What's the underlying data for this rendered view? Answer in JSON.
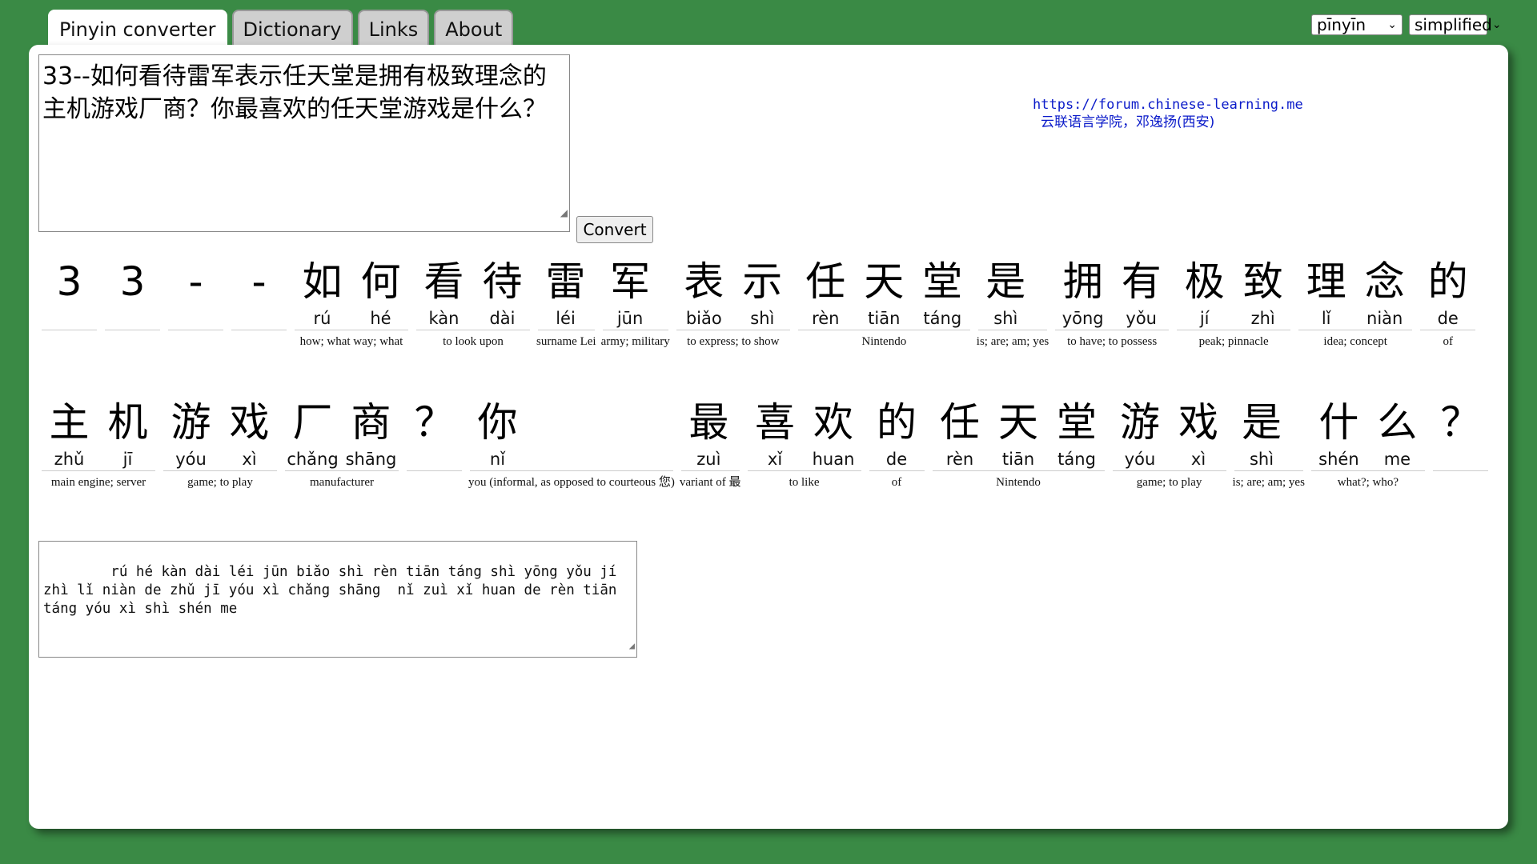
{
  "tabs": [
    {
      "label": "Pinyin converter",
      "active": true
    },
    {
      "label": "Dictionary",
      "active": false
    },
    {
      "label": "Links",
      "active": false
    },
    {
      "label": "About",
      "active": false
    }
  ],
  "selects": {
    "romanization": "pīnyīn",
    "script": "simplified"
  },
  "input": {
    "text": "33--如何看待雷军表示任天堂是拥有极致理念的主机游戏厂商？你最喜欢的任天堂游戏是什么？"
  },
  "convert_label": "Convert",
  "credit": {
    "url": "https://forum.chinese-learning.me",
    "name": "云联语言学院，邓逸扬(西安)"
  },
  "row1": [
    {
      "syls": [
        {
          "hz": "3",
          "py": ""
        }
      ],
      "gloss": ""
    },
    {
      "syls": [
        {
          "hz": "3",
          "py": ""
        }
      ],
      "gloss": ""
    },
    {
      "syls": [
        {
          "hz": "-",
          "py": ""
        }
      ],
      "gloss": ""
    },
    {
      "syls": [
        {
          "hz": "-",
          "py": ""
        }
      ],
      "gloss": ""
    },
    {
      "syls": [
        {
          "hz": "如",
          "py": "rú"
        },
        {
          "hz": "何",
          "py": "hé"
        }
      ],
      "gloss": "how; what way; what"
    },
    {
      "syls": [
        {
          "hz": "看",
          "py": "kàn"
        },
        {
          "hz": "待",
          "py": "dài"
        }
      ],
      "gloss": "to look upon"
    },
    {
      "syls": [
        {
          "hz": "雷",
          "py": "léi"
        }
      ],
      "gloss": "surname Lei"
    },
    {
      "syls": [
        {
          "hz": "军",
          "py": "jūn"
        }
      ],
      "gloss": "army; military"
    },
    {
      "syls": [
        {
          "hz": "表",
          "py": "biǎo"
        },
        {
          "hz": "示",
          "py": "shì"
        }
      ],
      "gloss": "to express; to show"
    },
    {
      "syls": [
        {
          "hz": "任",
          "py": "rèn"
        },
        {
          "hz": "天",
          "py": "tiān"
        },
        {
          "hz": "堂",
          "py": "táng"
        }
      ],
      "gloss": "Nintendo"
    },
    {
      "syls": [
        {
          "hz": "是",
          "py": "shì"
        }
      ],
      "gloss": "is; are; am; yes"
    },
    {
      "syls": [
        {
          "hz": "拥",
          "py": "yōng"
        },
        {
          "hz": "有",
          "py": "yǒu"
        }
      ],
      "gloss": "to have; to possess"
    },
    {
      "syls": [
        {
          "hz": "极",
          "py": "jí"
        },
        {
          "hz": "致",
          "py": "zhì"
        }
      ],
      "gloss": "peak; pinnacle"
    },
    {
      "syls": [
        {
          "hz": "理",
          "py": "lǐ"
        },
        {
          "hz": "念",
          "py": "niàn"
        }
      ],
      "gloss": "idea; concept"
    },
    {
      "syls": [
        {
          "hz": "的",
          "py": "de"
        }
      ],
      "gloss": "of"
    }
  ],
  "row2": [
    {
      "syls": [
        {
          "hz": "主",
          "py": "zhǔ"
        },
        {
          "hz": "机",
          "py": "jī"
        }
      ],
      "gloss": "main engine; server"
    },
    {
      "syls": [
        {
          "hz": "游",
          "py": "yóu"
        },
        {
          "hz": "戏",
          "py": "xì"
        }
      ],
      "gloss": "game; to play"
    },
    {
      "syls": [
        {
          "hz": "厂",
          "py": "chǎng"
        },
        {
          "hz": "商",
          "py": "shāng"
        }
      ],
      "gloss": "manufacturer"
    },
    {
      "syls": [
        {
          "hz": "？",
          "py": ""
        }
      ],
      "gloss": ""
    },
    {
      "syls": [
        {
          "hz": "你",
          "py": "nǐ"
        }
      ],
      "gloss": "you (informal, as opposed to courteous 您)"
    },
    {
      "syls": [
        {
          "hz": "最",
          "py": "zuì"
        }
      ],
      "gloss": "variant of 最"
    },
    {
      "syls": [
        {
          "hz": "喜",
          "py": "xǐ"
        },
        {
          "hz": "欢",
          "py": "huan"
        }
      ],
      "gloss": "to like"
    },
    {
      "syls": [
        {
          "hz": "的",
          "py": "de"
        }
      ],
      "gloss": "of"
    },
    {
      "syls": [
        {
          "hz": "任",
          "py": "rèn"
        },
        {
          "hz": "天",
          "py": "tiān"
        },
        {
          "hz": "堂",
          "py": "táng"
        }
      ],
      "gloss": "Nintendo"
    },
    {
      "syls": [
        {
          "hz": "游",
          "py": "yóu"
        },
        {
          "hz": "戏",
          "py": "xì"
        }
      ],
      "gloss": "game; to play"
    },
    {
      "syls": [
        {
          "hz": "是",
          "py": "shì"
        }
      ],
      "gloss": "is; are; am; yes"
    },
    {
      "syls": [
        {
          "hz": "什",
          "py": "shén"
        },
        {
          "hz": "么",
          "py": "me"
        }
      ],
      "gloss": "what?; who?"
    },
    {
      "syls": [
        {
          "hz": "？",
          "py": ""
        }
      ],
      "gloss": ""
    }
  ],
  "output": {
    "text": "    rú hé kàn dài léi jūn biǎo shì rèn tiān táng shì yōng yǒu jí zhì lǐ niàn de zhǔ jī yóu xì chǎng shāng  nǐ zuì xǐ huan de rèn tiān táng yóu xì shì shén me"
  }
}
